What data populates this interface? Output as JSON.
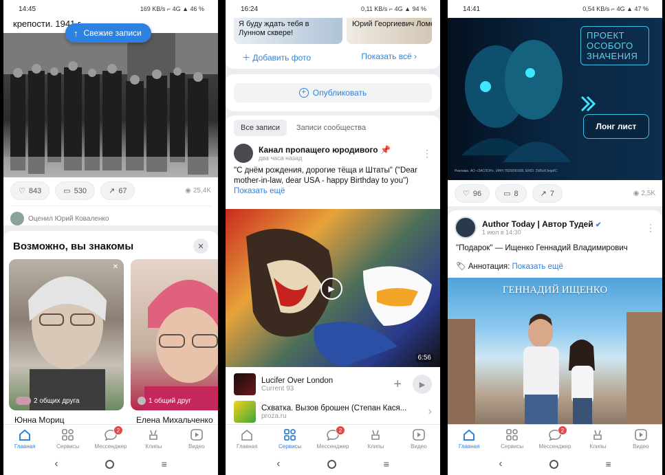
{
  "nav": {
    "items": [
      "Главная",
      "Сервисы",
      "Мессенджер",
      "Клипы",
      "Видео"
    ],
    "badge": "2"
  },
  "p1": {
    "status": {
      "time": "14:45",
      "right": "⌐ 4G ▲ 46 %",
      "speed": "169 KB/s"
    },
    "caption_tail": "крепости. 1941 г.",
    "fresh_button": "Свежие записи",
    "likes": "843",
    "comments": "530",
    "shares": "67",
    "views": "25,4K",
    "rated_by": "Оценил Юрий Коваленко",
    "suggest_title": "Возможно, вы знакомы",
    "people": [
      {
        "name": "Юнна Мориц",
        "mutual": "2 общих друга"
      },
      {
        "name": "Елена Михальченко",
        "mutual": "1 общий друг"
      }
    ]
  },
  "p2": {
    "status": {
      "time": "16:24",
      "right": "⌐ 4G ▲ 94 %",
      "speed": "0,11 KB/s"
    },
    "story1": "Я буду ждать тебя в Лунном сквере!",
    "story2": "Юрий Георгиевич Ломов-Оппоков \"НЕз",
    "add_photo": "Добавить фото",
    "show_all": "Показать всё",
    "publish": "Опубликовать",
    "tabs": [
      "Все записи",
      "Записи сообщества"
    ],
    "post_author": "Канал пропащего юродивого",
    "post_time": "два часа назад",
    "post_text": "\"С днём рождения, дорогие тёща и Штаты\" (\"Dear mother-in-law, dear USA - happy Birthday to you\")",
    "show_more": "Показать ещё",
    "duration": "6:56",
    "audio_title": "Lucifer Over London",
    "audio_artist": "Current 93",
    "link_title": "Схватка. Вызов брошен (Степан Кася...",
    "link_domain": "proza.ru"
  },
  "p3": {
    "status": {
      "time": "14:41",
      "right": "⌐ 4G ▲ 47 %",
      "speed": "0,54 KB/s"
    },
    "ad_title_lines": [
      "ПРОЕКТ",
      "ОСОБОГО",
      "ЗНАЧЕНИЯ"
    ],
    "ad_button": "Лонг лист",
    "ad_footer": "Реклама. АО «ЗАСЛОН», ИНН 7826090308, ERID: 2W5zFJvqefC",
    "likes": "96",
    "comments": "8",
    "shares": "7",
    "views": "2,5K",
    "post_author": "Author Today | Автор Тудей",
    "post_time": "1 июл в 14:30",
    "post_text": "\"Подарок\" — Ищенко Геннадий Владимирович",
    "annotation_label": "Аннотация:",
    "show_more": "Показать ещё",
    "cover_author": "Геннадий Ищенко"
  },
  "colors": {
    "accent": "#2d81e0",
    "badge": "#e64646"
  }
}
